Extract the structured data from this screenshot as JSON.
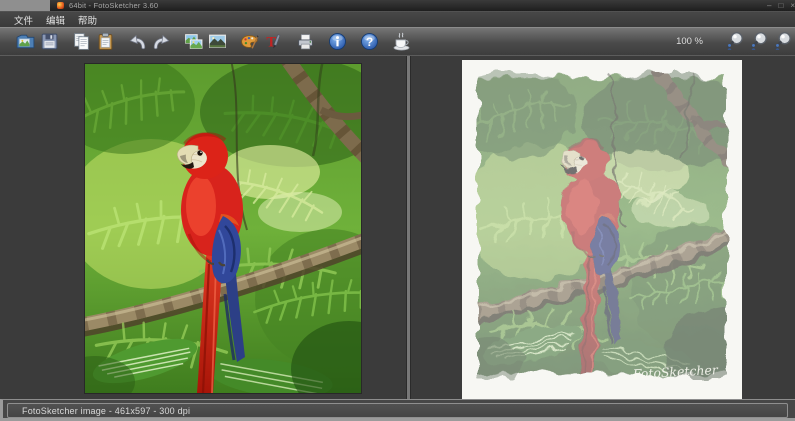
{
  "window": {
    "title": "64bit - FotoSketcher 3.60",
    "controls": [
      {
        "name": "minimize",
        "glyph": "–"
      },
      {
        "name": "maximize",
        "glyph": "□"
      },
      {
        "name": "close",
        "glyph": "×"
      }
    ]
  },
  "menu": {
    "items": [
      {
        "id": "file",
        "label": "文件"
      },
      {
        "id": "edit",
        "label": "编辑"
      },
      {
        "id": "help",
        "label": "帮助"
      }
    ]
  },
  "toolbar": {
    "buttons": [
      {
        "name": "open-image",
        "icon": "open",
        "gap": false
      },
      {
        "name": "save-image",
        "icon": "save",
        "gap": false
      },
      {
        "name": "copy",
        "icon": "copy",
        "gap": true
      },
      {
        "name": "paste",
        "icon": "paste",
        "gap": false
      },
      {
        "name": "undo",
        "icon": "undo",
        "gap": true
      },
      {
        "name": "redo",
        "icon": "redo",
        "gap": false
      },
      {
        "name": "compare-images",
        "icon": "compare",
        "gap": true
      },
      {
        "name": "view-original",
        "icon": "photo",
        "gap": false
      },
      {
        "name": "drawing-parameters",
        "icon": "palette",
        "gap": true
      },
      {
        "name": "add-text",
        "icon": "text",
        "gap": false
      },
      {
        "name": "print",
        "icon": "print",
        "gap": true
      },
      {
        "name": "about",
        "icon": "info",
        "gap": true
      },
      {
        "name": "help",
        "icon": "helpq",
        "gap": true
      },
      {
        "name": "donate-coffee",
        "icon": "coffee",
        "gap": true
      }
    ],
    "zoom_level": "100 %",
    "zoom_buttons": [
      {
        "name": "zoom-in",
        "icon": "zoom"
      },
      {
        "name": "zoom-out",
        "icon": "zoom"
      },
      {
        "name": "zoom-fit",
        "icon": "zoom"
      }
    ]
  },
  "canvas": {
    "original_description": "photo of scarlet macaw on branch in jungle",
    "painted_description": "painted FotoSketcher rendering of the same macaw",
    "painted_signature": "FotoSketcher"
  },
  "statusbar": {
    "text": "FotoSketcher image - 461x597 - 300 dpi"
  },
  "colors": {
    "titlebar": "#262626",
    "menubar": "#3f3f3f",
    "toolbar": "#5a5a5a",
    "panel_bg": "#3b3b3b",
    "paper": "#f7f7f3",
    "status_text": "#d8d8d8"
  }
}
